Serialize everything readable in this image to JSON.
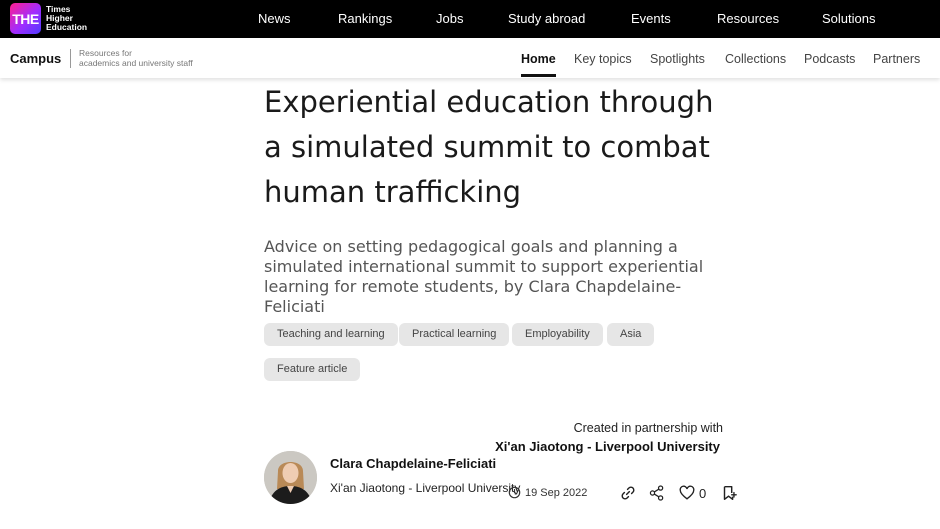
{
  "brand": {
    "logo_text": "THE",
    "name_lines": [
      "Times",
      "Higher",
      "Education"
    ],
    "gradient": [
      "#ff1f8f",
      "#a12cff",
      "#4f3cff"
    ]
  },
  "topnav": {
    "items": [
      "News",
      "Rankings",
      "Jobs",
      "Study abroad",
      "Events",
      "Resources",
      "Solutions"
    ]
  },
  "campus": {
    "title": "Campus",
    "subtitle_lines": [
      "Resources for",
      "academics and university staff"
    ],
    "nav": [
      {
        "label": "Home",
        "active": true
      },
      {
        "label": "Key topics",
        "active": false
      },
      {
        "label": "Spotlights",
        "active": false
      },
      {
        "label": "Collections",
        "active": false
      },
      {
        "label": "Podcasts",
        "active": false
      },
      {
        "label": "Partners",
        "active": false
      }
    ]
  },
  "article": {
    "title_lines": [
      "Experiential education through",
      "a simulated summit to combat",
      "human trafficking"
    ],
    "standfirst_lines": [
      "Advice on setting pedagogical goals and planning a",
      "simulated international summit to support experiential",
      "learning for remote students, by Clara Chapdelaine-Feliciati"
    ],
    "tags": [
      "Teaching and learning",
      "Practical learning",
      "Employability",
      "Asia",
      "Feature article"
    ],
    "partnership_label": "Created in partnership with",
    "partner_name": "Xi'an Jiaotong - Liverpool University",
    "author": {
      "name": "Clara Chapdelaine-Feliciati",
      "institution": "Xi'an Jiaotong - Liverpool University"
    },
    "date": "19 Sep 2022",
    "likes": "0"
  },
  "icons": [
    "clock-icon",
    "link-icon",
    "share-icon",
    "heart-icon",
    "bookmark-icon"
  ]
}
